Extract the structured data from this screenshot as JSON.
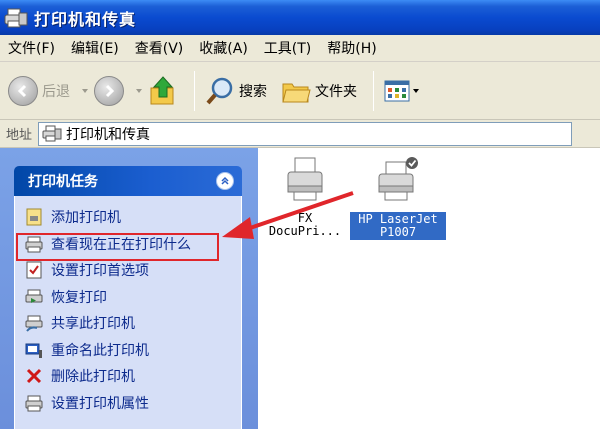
{
  "window": {
    "title": "打印机和传真"
  },
  "menu": [
    "文件(F)",
    "编辑(E)",
    "查看(V)",
    "收藏(A)",
    "工具(T)",
    "帮助(H)"
  ],
  "toolbar": {
    "back": "后退",
    "search": "搜索",
    "folders": "文件夹"
  },
  "address": {
    "label": "地址",
    "value": "打印机和传真"
  },
  "tasks": {
    "title": "打印机任务",
    "items": [
      {
        "label": "添加打印机",
        "icon": "add-printer-icon"
      },
      {
        "label": "查看现在正在打印什么",
        "icon": "print-queue-icon"
      },
      {
        "label": "设置打印首选项",
        "icon": "print-preferences-icon"
      },
      {
        "label": "恢复打印",
        "icon": "resume-printing-icon"
      },
      {
        "label": "共享此打印机",
        "icon": "share-printer-icon"
      },
      {
        "label": "重命名此打印机",
        "icon": "rename-printer-icon"
      },
      {
        "label": "删除此打印机",
        "icon": "delete-printer-icon"
      },
      {
        "label": "设置打印机属性",
        "icon": "printer-properties-icon"
      }
    ]
  },
  "printers": [
    {
      "line1": "FX",
      "line2": "DocuPri...",
      "selected": false,
      "default": false
    },
    {
      "line1": "HP LaserJet",
      "line2": "P1007",
      "selected": true,
      "default": true
    }
  ],
  "colors": {
    "title_bar": "#0a4bd0",
    "task_pane": "#7ba2e7",
    "selection": "#316ac5",
    "highlight": "#e0262b"
  }
}
